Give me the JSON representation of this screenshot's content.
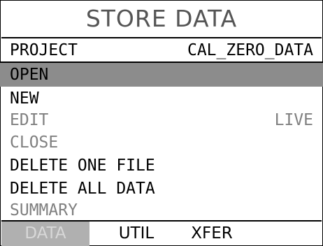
{
  "title": "STORE DATA",
  "project": {
    "label": "PROJECT",
    "value": "CAL_ZERO_DATA"
  },
  "menu": [
    {
      "label": "OPEN",
      "value": "",
      "state": "selected"
    },
    {
      "label": "NEW",
      "value": "",
      "state": "enabled"
    },
    {
      "label": "EDIT",
      "value": "LIVE",
      "state": "disabled"
    },
    {
      "label": "CLOSE",
      "value": "",
      "state": "disabled"
    },
    {
      "label": "DELETE ONE FILE",
      "value": "",
      "state": "enabled"
    },
    {
      "label": "DELETE ALL DATA",
      "value": "",
      "state": "enabled"
    },
    {
      "label": "SUMMARY",
      "value": "",
      "state": "disabled"
    }
  ],
  "tabs": [
    {
      "label": "DATA",
      "active": true
    },
    {
      "label": "UTIL",
      "active": false
    },
    {
      "label": "XFER",
      "active": false
    }
  ],
  "colors": {
    "selected_bg": "#8c8c8c",
    "disabled_text": "#808080",
    "title_text": "#555555",
    "active_tab_bg": "#b0b0b0"
  }
}
